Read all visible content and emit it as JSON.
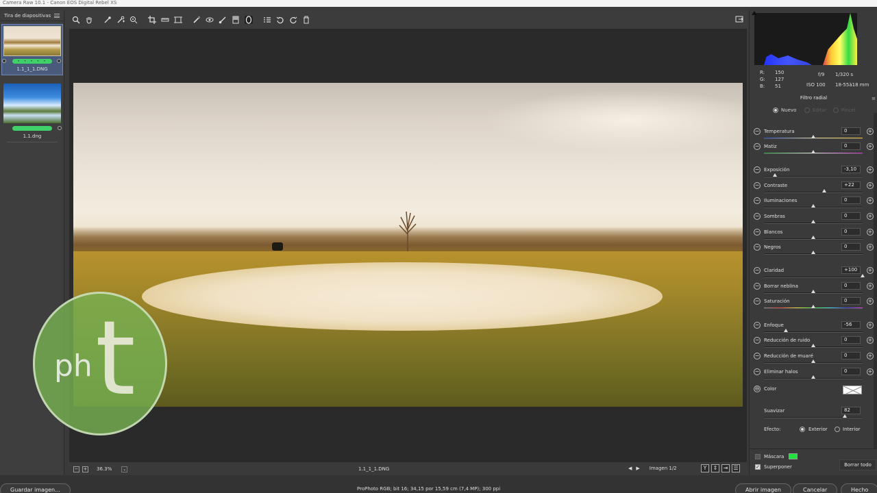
{
  "window": {
    "title": "Camera Raw 10.1  -  Canon EOS Digital Rebel XS"
  },
  "filmstrip": {
    "header": "Tira de diapositivas",
    "items": [
      {
        "name": "1.1_1_1.DNG",
        "rating": "• • • • •",
        "selected": true
      },
      {
        "name": "1.1.dng",
        "rating": "",
        "selected": false
      }
    ]
  },
  "toolbar": {
    "tools": [
      "zoom-icon",
      "hand-icon",
      "white-balance-icon",
      "color-sampler-icon",
      "target-adjustment-icon",
      "crop-icon",
      "straighten-icon",
      "transform-icon",
      "spot-removal-icon",
      "red-eye-icon",
      "adjustment-brush-icon",
      "graduated-filter-icon",
      "radial-filter-icon",
      "list-icon",
      "rotate-left-icon",
      "rotate-right-icon",
      "trash-icon"
    ],
    "active_tool": "radial-filter-icon"
  },
  "canvas": {
    "zoom": "36.3%",
    "file_name": "1.1_1_1.DNG",
    "image_count": "Imagen 1/2",
    "watermark_text_1": "ph",
    "watermark_text_2": "t"
  },
  "bottombar": {
    "save": "Guardar imagen...",
    "workflow": "ProPhoto RGB; bit 16; 34,15 por 15,59 cm (7,4 MP); 300 ppi",
    "open": "Abrir imagen",
    "cancel": "Cancelar",
    "done": "Hecho"
  },
  "readout": {
    "r_label": "R:",
    "r": "150",
    "g_label": "G:",
    "g": "127",
    "b_label": "B:",
    "b": "51",
    "aperture": "f/9",
    "shutter": "1/320 s",
    "iso": "ISO 100",
    "lens": "18-55à18 mm"
  },
  "panel": {
    "title": "Filtro radial",
    "modes": {
      "new": "Nuevo",
      "edit": "Editar",
      "brush": "Pincel"
    },
    "sliders": [
      {
        "label": "Temperatura",
        "value": "0",
        "pos": 0.5,
        "track": "temp"
      },
      {
        "label": "Matiz",
        "value": "0",
        "pos": 0.5,
        "track": "tint"
      },
      {
        "label": "Exposición",
        "value": "-3,10",
        "pos": 0.11,
        "track": ""
      },
      {
        "label": "Contraste",
        "value": "+22",
        "pos": 0.61,
        "track": ""
      },
      {
        "label": "Iluminaciones",
        "value": "0",
        "pos": 0.5,
        "track": ""
      },
      {
        "label": "Sombras",
        "value": "0",
        "pos": 0.5,
        "track": ""
      },
      {
        "label": "Blancos",
        "value": "0",
        "pos": 0.5,
        "track": ""
      },
      {
        "label": "Negros",
        "value": "0",
        "pos": 0.5,
        "track": ""
      },
      {
        "label": "Claridad",
        "value": "+100",
        "pos": 1.0,
        "track": ""
      },
      {
        "label": "Borrar neblina",
        "value": "0",
        "pos": 0.5,
        "track": ""
      },
      {
        "label": "Saturación",
        "value": "0",
        "pos": 0.5,
        "track": "sat"
      },
      {
        "label": "Enfoque",
        "value": "-56",
        "pos": 0.22,
        "track": ""
      },
      {
        "label": "Reducción de ruido",
        "value": "0",
        "pos": 0.5,
        "track": ""
      },
      {
        "label": "Reducción de muaré",
        "value": "0",
        "pos": 0.5,
        "track": ""
      },
      {
        "label": "Eliminar halos",
        "value": "0",
        "pos": 0.5,
        "track": ""
      }
    ],
    "color_label": "Color",
    "feather": {
      "label": "Suavizar",
      "value": "82",
      "pos": 0.82
    },
    "effect": {
      "label": "Efecto:",
      "outer": "Exterior",
      "inner": "Interior"
    },
    "mask_label": "Máscara",
    "overlay_label": "Superponer",
    "clear_all": "Borrar todo"
  }
}
